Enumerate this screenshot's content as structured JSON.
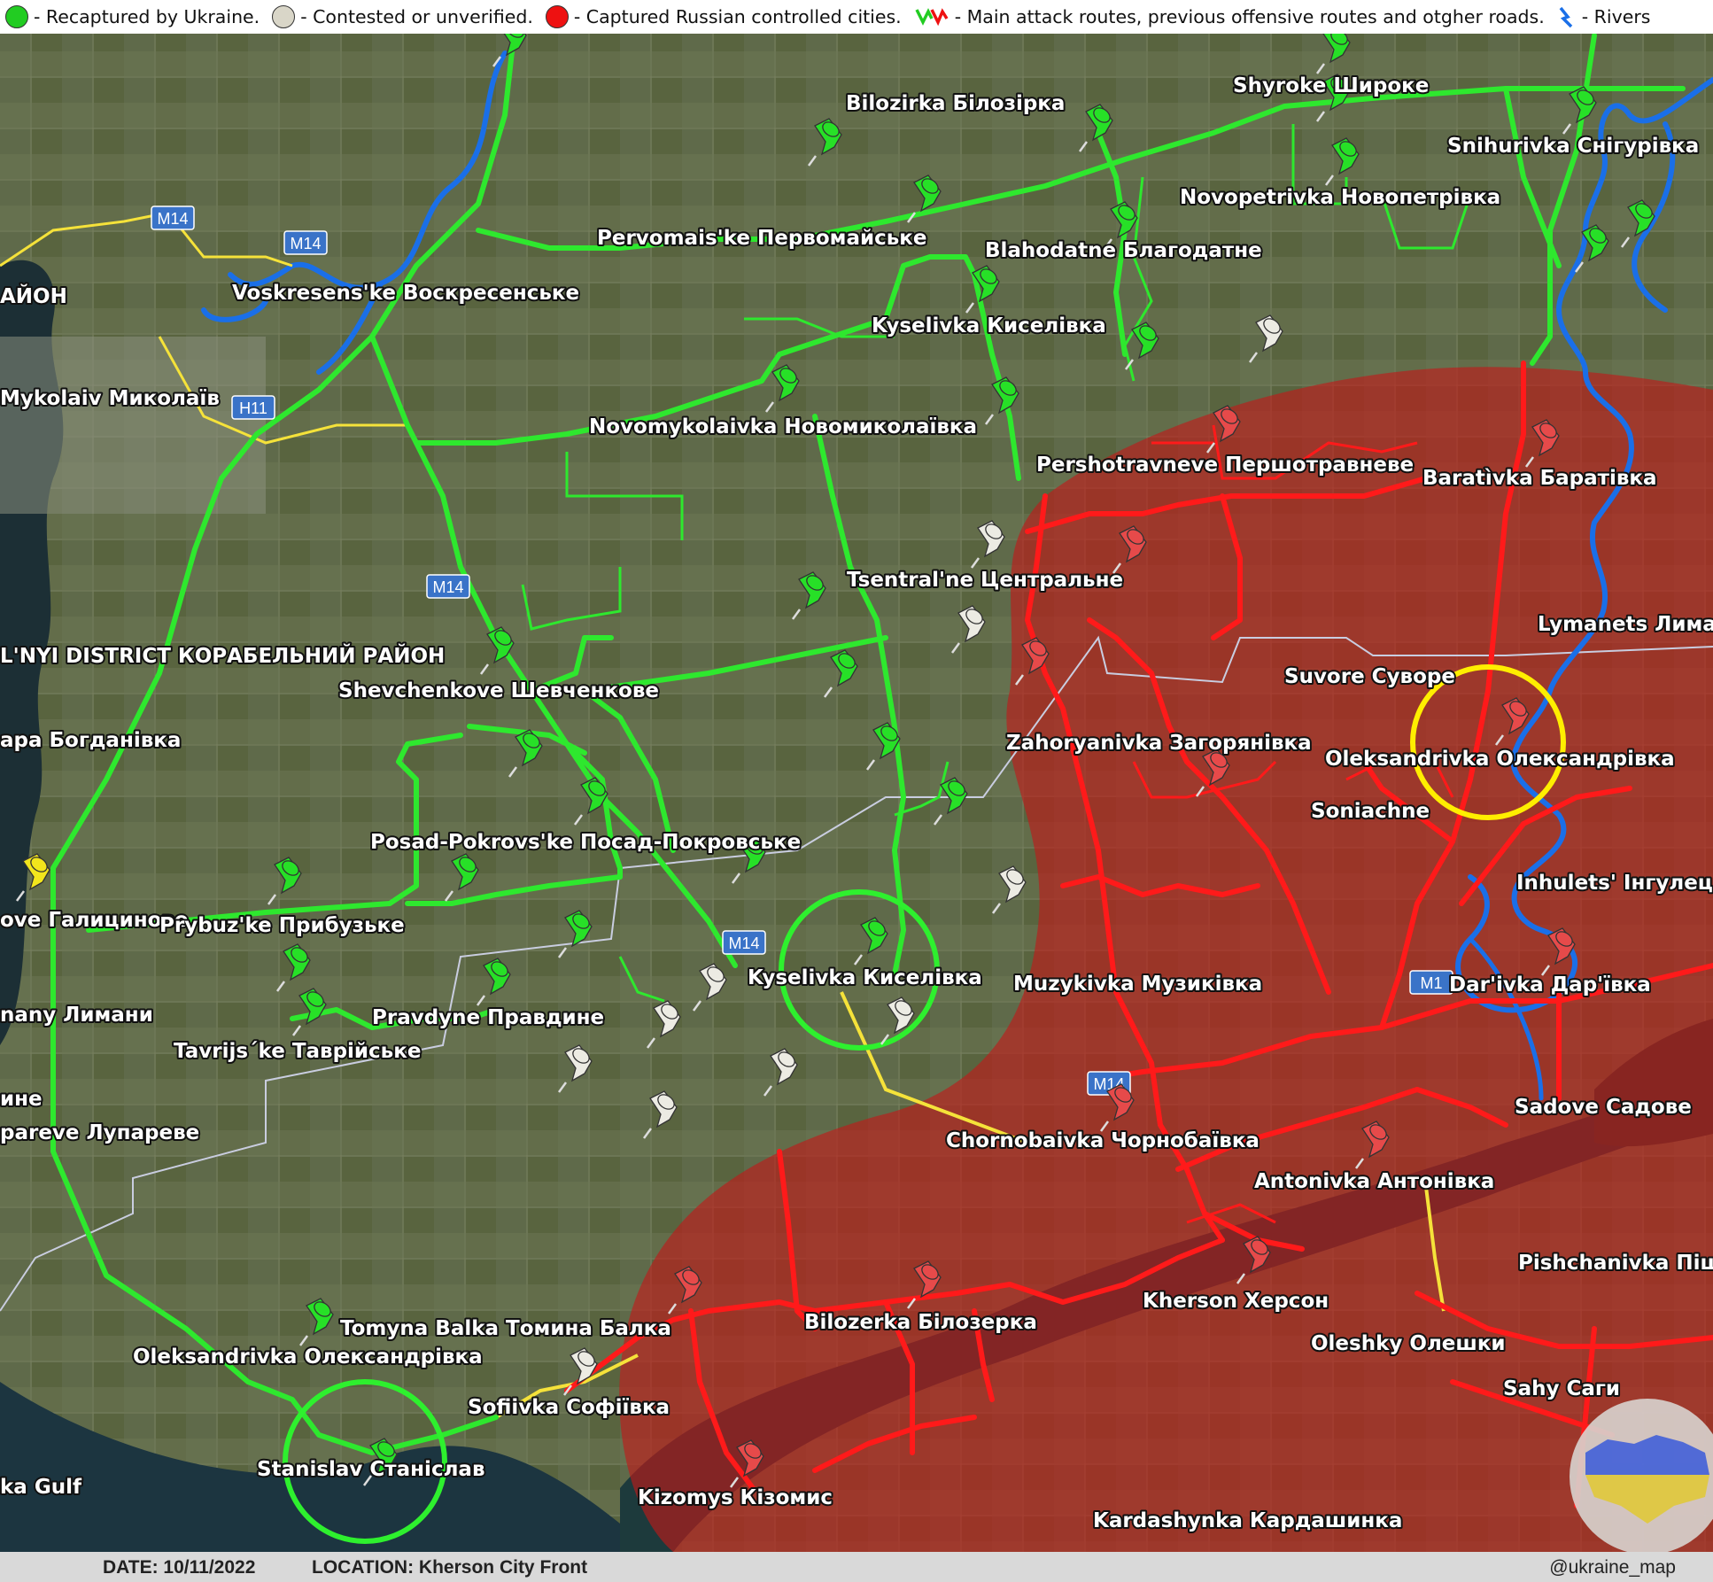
{
  "legend": {
    "recaptured_label": "- Recaptured by Ukraine.",
    "contested_label": "- Contested or unverified.",
    "captured_label": "- Captured Russian controlled cities.",
    "routes_label": "- Main attack routes, previous offensive routes and otgher roads.",
    "rivers_label": "- Rivers",
    "color_ukraine": "#22cc22",
    "color_contested": "#d9d6c8",
    "color_russia": "#ee1111",
    "color_river": "#1a6fe8"
  },
  "colors": {
    "zone_russia": "#c21818",
    "road_green": "#2ee82e",
    "road_red": "#ff1a1a",
    "road_yellow": "#f5e23a",
    "river": "#1a6fe8",
    "water": "#1b2f33",
    "land": "#5d6848",
    "circle_green": "#2ef02e",
    "circle_yellow": "#ffee00"
  },
  "roads": [
    "M14",
    "M14",
    "M14",
    "M14",
    "M14",
    "M1",
    "H11"
  ],
  "labels": [
    "Bilozirka Білозірка",
    "Shyroke Широке",
    "Snihurivka Снігурівка",
    "Novopetrivka Новопетрівка",
    "Pervomais'ke Первомайське",
    "Blahodatne Благодатне",
    "Voskresens'ke Воскресенське",
    "АЙОН",
    "Mykolaiv Миколаїв",
    "Kyselivka Киселівка",
    "Novomykolaivka Новомиколаївка",
    "Pershotravneve Першотравневе",
    "Baratìvka Баратівка",
    "Tsentral'ne Центральне",
    "Lymanets Лиманець",
    "L'NYI DISTRICT КОРАБЕЛЬНИЙ РАЙОН",
    "Shevchenkove Шевченкове",
    "Suvore Суворе",
    "ара Богданівка",
    "Zahoryanivka Загорянівка",
    "Oleksandrivka Олександрівка",
    "Soniachne",
    "Posad-Pokrovs'ke Посад-Покровське",
    "Inhulets' Інгулець",
    "ove Галицинове",
    "Prybuz'ke Прибузьке",
    "Kyselivka Киселівка",
    "Muzykivka Музиківка",
    "Dar'ivka Дар'ївка",
    "nany Лимани",
    "Pravdyne Правдине",
    "Tavrijs´ke Таврійське",
    "ине",
    "pareve Лупареве",
    "Sadove Садове",
    "Chornobaivka Чорнобаївка",
    "Antonivka Антонівка",
    "Pishchanivka Піщанівка",
    "Kherson Херсон",
    "Tomyna Balka Томина Балка",
    "Bilozerka Білозерка",
    "Oleshky Олешки",
    "Oleksandrivka Олександрівка",
    "Sofiivka Софіївка",
    "Sahy Саги",
    "Stanislav Станіслав",
    "ka Gulf",
    "Kizomys Кізомис",
    "Kardashynka Кардашинка"
  ],
  "footer": {
    "date": "DATE: 10/11/2022",
    "location": "LOCATION: Kherson City Front",
    "handle": "@ukraine_map"
  },
  "pins": {
    "green_count": 37,
    "white_count": 13,
    "red_count": 13,
    "yellow_count": 1
  }
}
